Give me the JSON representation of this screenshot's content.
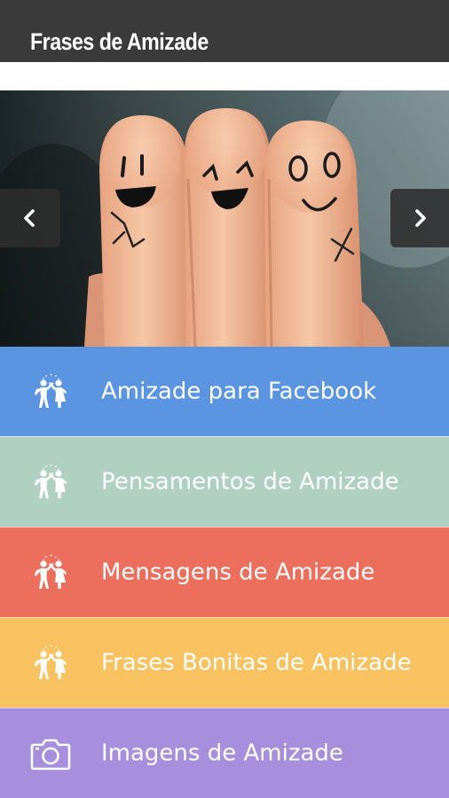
{
  "app_bar": {
    "title": "Frases de Amizade",
    "background": "#3a3a3a"
  },
  "carousel": {
    "prev_icon": "chevron-left-icon",
    "next_icon": "chevron-right-icon"
  },
  "menu": {
    "items": [
      {
        "label": "Amizade para Facebook",
        "icon": "friends-icon",
        "color": "#5b95e2"
      },
      {
        "label": "Pensamentos de Amizade",
        "icon": "friends-icon",
        "color": "#b0d1c2"
      },
      {
        "label": "Mensagens de Amizade",
        "icon": "friends-icon",
        "color": "#ec6e5c"
      },
      {
        "label": "Frases Bonitas de Amizade",
        "icon": "friends-icon",
        "color": "#f7c25f"
      },
      {
        "label": "Imagens de Amizade",
        "icon": "camera-icon",
        "color": "#a88fdd"
      }
    ]
  }
}
